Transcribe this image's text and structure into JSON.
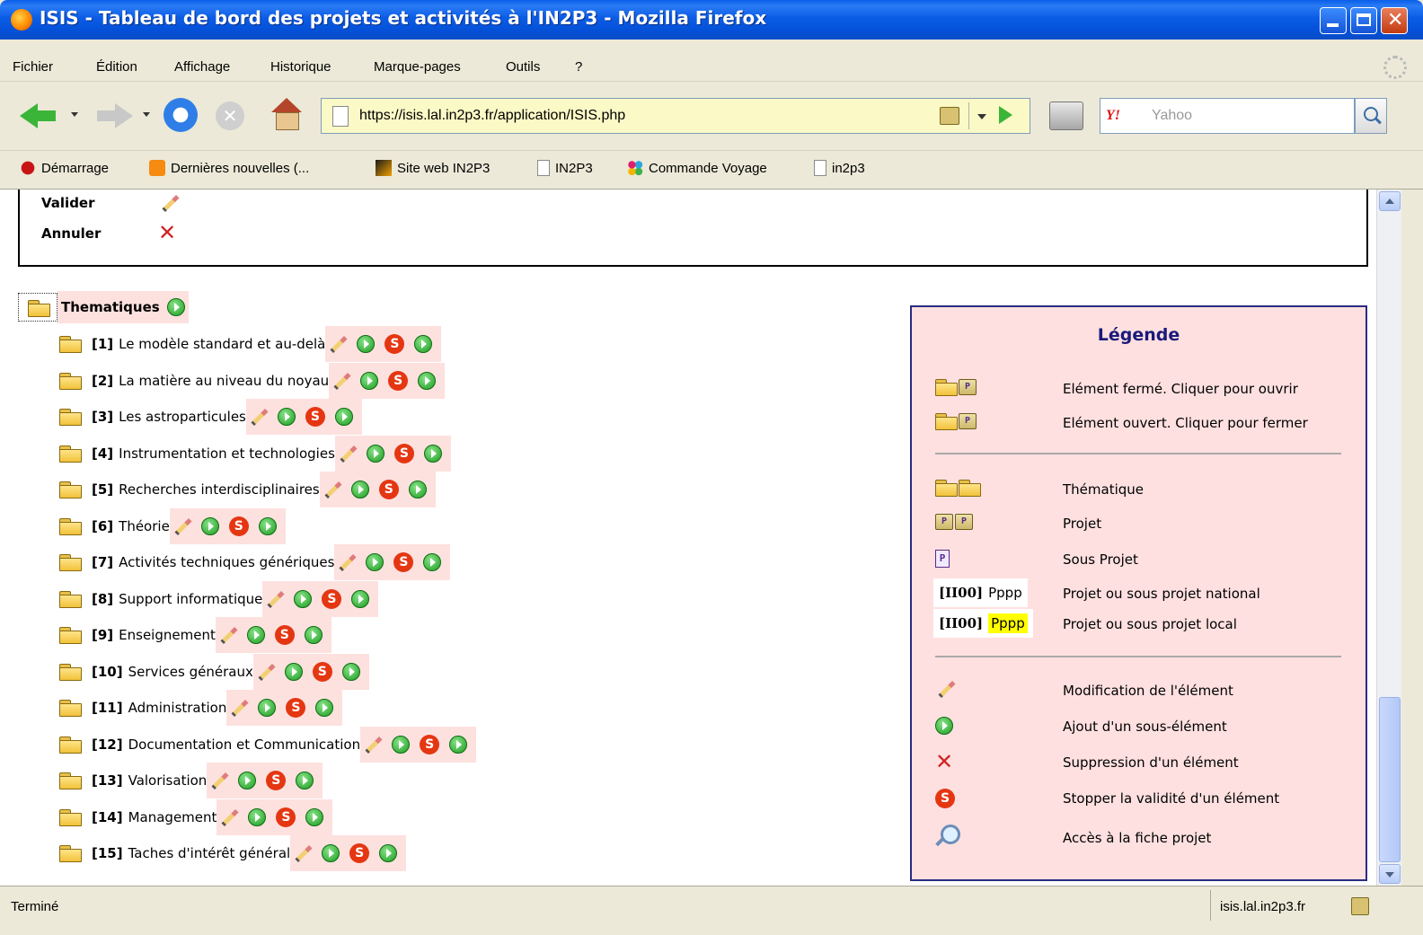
{
  "window": {
    "title": "ISIS - Tableau de bord des projets et activités à l'IN2P3 - Mozilla Firefox"
  },
  "menu": [
    "Fichier",
    "Édition",
    "Affichage",
    "Historique",
    "Marque-pages",
    "Outils",
    "?"
  ],
  "url": "https://isis.lal.in2p3.fr/application/ISIS.php",
  "search": {
    "placeholder": "Yahoo",
    "engine": "Y!"
  },
  "bookmarks": [
    {
      "label": "Démarrage",
      "icon": "red"
    },
    {
      "label": "Dernières nouvelles (...",
      "icon": "rss"
    },
    {
      "label": "Site web IN2P3",
      "icon": "in2p3"
    },
    {
      "label": "IN2P3",
      "icon": "page"
    },
    {
      "label": "Commande Voyage",
      "icon": "dots"
    },
    {
      "label": "in2p3",
      "icon": "page"
    }
  ],
  "actions_box": {
    "valider": "Valider",
    "annuler": "Annuler"
  },
  "tree": {
    "root": "Thematiques",
    "items": [
      {
        "code": "[1]",
        "name": "Le modèle standard et au-delà"
      },
      {
        "code": "[2]",
        "name": "La matière au niveau du noyau"
      },
      {
        "code": "[3]",
        "name": "Les astroparticules"
      },
      {
        "code": "[4]",
        "name": "Instrumentation et technologies"
      },
      {
        "code": "[5]",
        "name": "Recherches interdisciplinaires"
      },
      {
        "code": "[6]",
        "name": "Théorie"
      },
      {
        "code": "[7]",
        "name": "Activités techniques génériques"
      },
      {
        "code": "[8]",
        "name": "Support informatique"
      },
      {
        "code": "[9]",
        "name": "Enseignement"
      },
      {
        "code": "[10]",
        "name": "Services généraux"
      },
      {
        "code": "[11]",
        "name": "Administration"
      },
      {
        "code": "[12]",
        "name": "Documentation et Communication"
      },
      {
        "code": "[13]",
        "name": "Valorisation"
      },
      {
        "code": "[14]",
        "name": "Management"
      },
      {
        "code": "[15]",
        "name": "Taches d'intérêt général"
      }
    ]
  },
  "legend": {
    "title": "Légende",
    "closed": "Elément fermé. Cliquer pour ouvrir",
    "opened": "Elément ouvert. Cliquer pour fermer",
    "thematique": "Thématique",
    "projet": "Projet",
    "sous_projet": "Sous Projet",
    "ex_code": "[II00]",
    "ex_name": "Pppp",
    "national": "Projet ou sous projet national",
    "local": "Projet ou sous projet local",
    "modif": "Modification de l'élément",
    "ajout": "Ajout d'un sous-élément",
    "suppression": "Suppression d'un élément",
    "stopper": "Stopper la validité d'un élément",
    "acces": "Accès à la fiche projet"
  },
  "status": {
    "text": "Terminé",
    "host": "isis.lal.in2p3.fr"
  }
}
